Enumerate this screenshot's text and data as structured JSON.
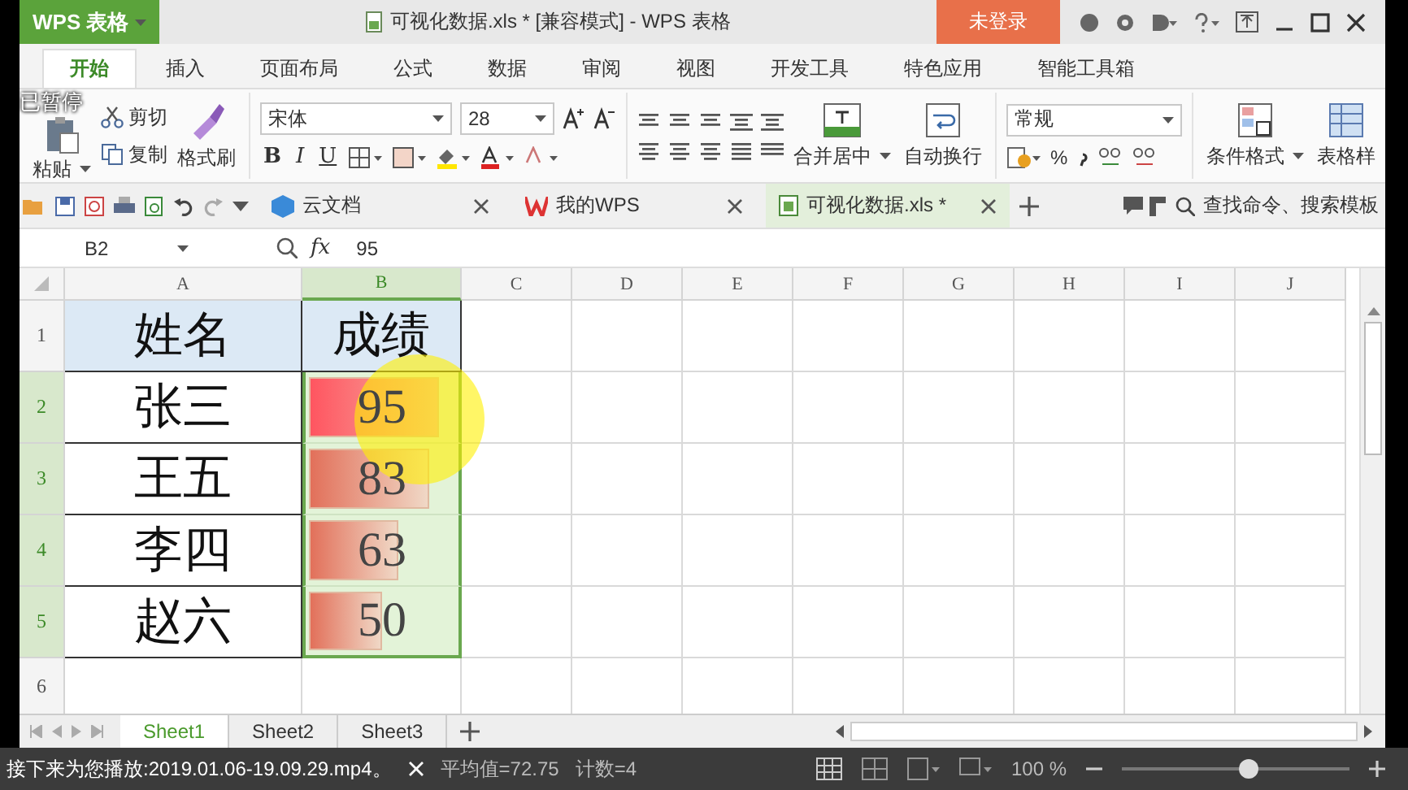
{
  "player": {
    "status": "已暂停",
    "next_up": "接下来为您播放:2019.01.06-19.09.29.mp4。"
  },
  "app_button": "WPS 表格",
  "window": {
    "title": "可视化数据.xls * [兼容模式] - WPS 表格"
  },
  "login_button": "未登录",
  "menu_tabs": [
    {
      "label": "开始",
      "selected": true
    },
    {
      "label": "插入",
      "selected": false
    },
    {
      "label": "页面布局",
      "selected": false
    },
    {
      "label": "公式",
      "selected": false
    },
    {
      "label": "数据",
      "selected": false
    },
    {
      "label": "审阅",
      "selected": false
    },
    {
      "label": "视图",
      "selected": false
    },
    {
      "label": "开发工具",
      "selected": false
    },
    {
      "label": "特色应用",
      "selected": false
    },
    {
      "label": "智能工具箱",
      "selected": false
    }
  ],
  "ribbon": {
    "paste": "粘贴",
    "cut": "剪切",
    "copy": "复制",
    "format_painter": "格式刷",
    "font": "宋体",
    "font_size": "28",
    "style_buttons": [
      "B",
      "I",
      "U"
    ],
    "merge": "合并居中",
    "wrap": "自动换行",
    "number_format": "常规",
    "percent": "%",
    "conditional_format": "条件格式",
    "table_style": "表格样"
  },
  "doc_tabs": [
    {
      "label": "云文档",
      "selected": false
    },
    {
      "label": "我的WPS",
      "selected": false
    },
    {
      "label": "可视化数据.xls *",
      "selected": true
    }
  ],
  "search": {
    "placeholder": "查找命令、搜索模板"
  },
  "formula_bar": {
    "cell": "B2",
    "fx": "fx",
    "value": "95"
  },
  "columns": [
    {
      "label": "A",
      "selected": false
    },
    {
      "label": "B",
      "selected": true
    },
    {
      "label": "C",
      "selected": false
    },
    {
      "label": "D",
      "selected": false
    },
    {
      "label": "E",
      "selected": false
    },
    {
      "label": "F",
      "selected": false
    },
    {
      "label": "G",
      "selected": false
    },
    {
      "label": "H",
      "selected": false
    },
    {
      "label": "I",
      "selected": false
    },
    {
      "label": "J",
      "selected": false
    }
  ],
  "rows": [
    {
      "label": "1",
      "selected": false,
      "kind": "header",
      "name": "姓名",
      "score": "成绩"
    },
    {
      "label": "2",
      "selected": true,
      "kind": "data",
      "name": "张三",
      "score": "95",
      "level": 0.93
    },
    {
      "label": "3",
      "selected": true,
      "kind": "data",
      "name": "王五",
      "score": "83",
      "level": 0.85
    },
    {
      "label": "4",
      "selected": true,
      "kind": "data",
      "name": "李四",
      "score": "63",
      "level": 0.64
    },
    {
      "label": "5",
      "selected": true,
      "kind": "data",
      "name": "赵六",
      "score": "50",
      "level": 0.52
    },
    {
      "label": "6",
      "selected": false,
      "kind": "empty"
    }
  ],
  "sheet_tabs": [
    {
      "label": "Sheet1",
      "selected": true
    },
    {
      "label": "Sheet2",
      "selected": false
    },
    {
      "label": "Sheet3",
      "selected": false
    }
  ],
  "status": {
    "average": "平均值=72.75",
    "count": "计数=4",
    "zoom": "100 %",
    "zoom_slider": {
      "level": 0.56
    }
  }
}
